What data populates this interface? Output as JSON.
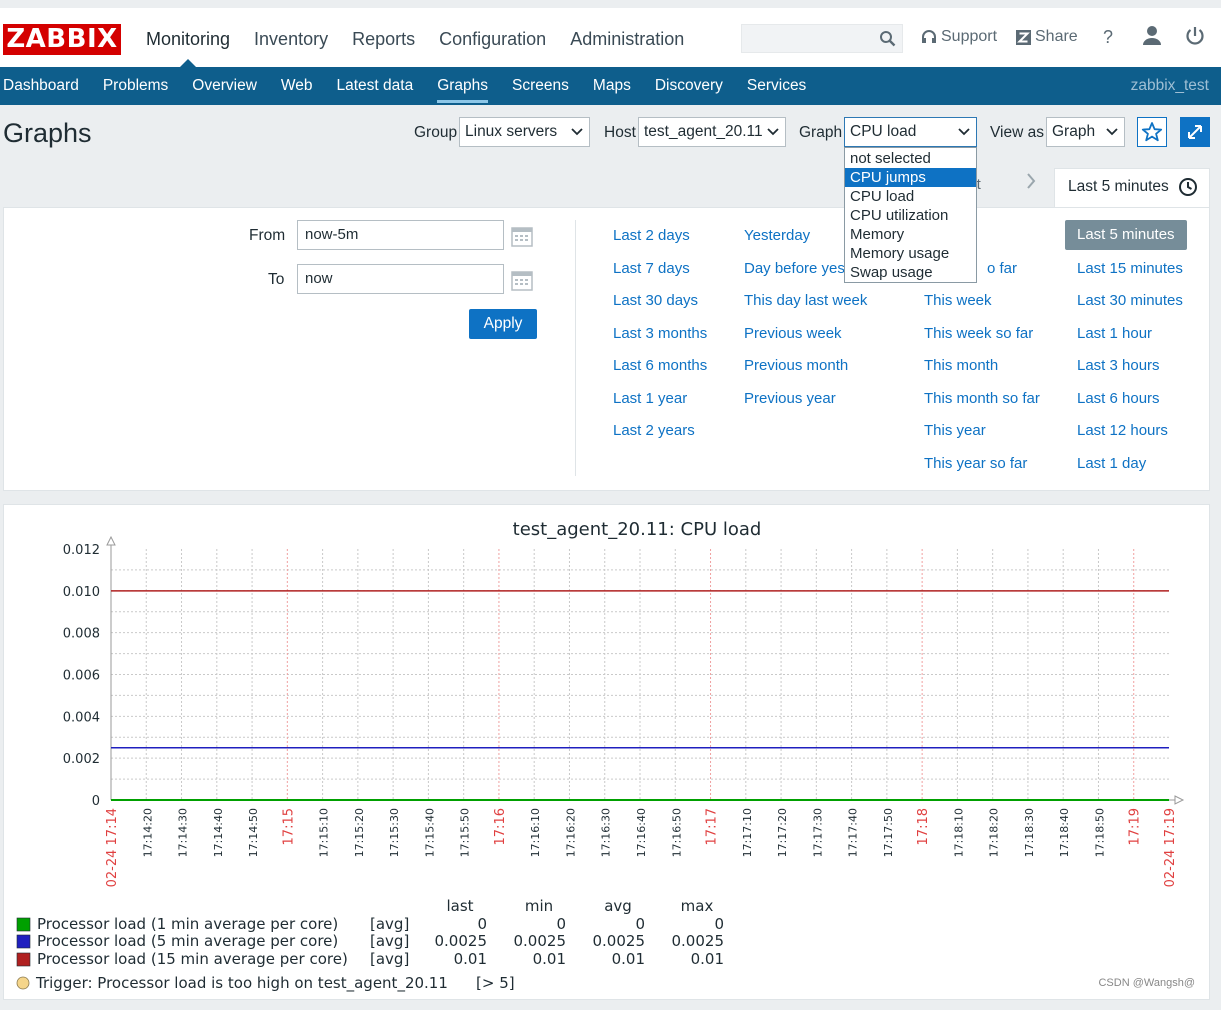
{
  "logo": "ZABBIX",
  "main_menu": [
    "Monitoring",
    "Inventory",
    "Reports",
    "Configuration",
    "Administration"
  ],
  "header_links": {
    "support": "Support",
    "share": "Share",
    "help": "?"
  },
  "sub_menu": [
    "Dashboard",
    "Problems",
    "Overview",
    "Web",
    "Latest data",
    "Graphs",
    "Screens",
    "Maps",
    "Discovery",
    "Services"
  ],
  "user": "zabbix_test",
  "page": {
    "title": "Graphs",
    "group_label": "Group",
    "group_value": "Linux servers",
    "host_label": "Host",
    "host_value": "test_agent_20.11",
    "graph_label": "Graph",
    "graph_value": "CPU load",
    "view_label": "View as",
    "view_value": "Graph"
  },
  "graph_options": [
    "not selected",
    "CPU jumps",
    "CPU load",
    "CPU utilization",
    "Memory",
    "Memory usage",
    "Swap usage"
  ],
  "timeline": {
    "zoom_out": "out",
    "active_tab": "Last 5 minutes"
  },
  "filter": {
    "from_label": "From",
    "from_value": "now-5m",
    "to_label": "To",
    "to_value": "now",
    "apply": "Apply"
  },
  "quick_ranges": {
    "col1": [
      "Last 2 days",
      "Last 7 days",
      "Last 30 days",
      "Last 3 months",
      "Last 6 months",
      "Last 1 year",
      "Last 2 years"
    ],
    "col2": [
      "Yesterday",
      "Day before yes",
      "This day last week",
      "Previous week",
      "Previous month",
      "Previous year"
    ],
    "col3": [
      "o far",
      "This week",
      "This week so far",
      "This month",
      "This month so far",
      "This year",
      "This year so far"
    ],
    "col4": [
      "Last 5 minutes",
      "Last 15 minutes",
      "Last 30 minutes",
      "Last 1 hour",
      "Last 3 hours",
      "Last 6 hours",
      "Last 12 hours",
      "Last 1 day"
    ]
  },
  "chart_data": {
    "type": "line",
    "title": "test_agent_20.11: CPU load",
    "ylim": [
      0,
      0.012
    ],
    "yticks": [
      "0.012",
      "0.010",
      "0.008",
      "0.006",
      "0.004",
      "0.002",
      "0"
    ],
    "xticks": [
      {
        "label": "02-24 17:14",
        "red": true
      },
      {
        "label": "17:14:20",
        "red": false
      },
      {
        "label": "17:14:30",
        "red": false
      },
      {
        "label": "17:14:40",
        "red": false
      },
      {
        "label": "17:14:50",
        "red": false
      },
      {
        "label": "17:15",
        "red": true
      },
      {
        "label": "17:15:10",
        "red": false
      },
      {
        "label": "17:15:20",
        "red": false
      },
      {
        "label": "17:15:30",
        "red": false
      },
      {
        "label": "17:15:40",
        "red": false
      },
      {
        "label": "17:15:50",
        "red": false
      },
      {
        "label": "17:16",
        "red": true
      },
      {
        "label": "17:16:10",
        "red": false
      },
      {
        "label": "17:16:20",
        "red": false
      },
      {
        "label": "17:16:30",
        "red": false
      },
      {
        "label": "17:16:40",
        "red": false
      },
      {
        "label": "17:16:50",
        "red": false
      },
      {
        "label": "17:17",
        "red": true
      },
      {
        "label": "17:17:10",
        "red": false
      },
      {
        "label": "17:17:20",
        "red": false
      },
      {
        "label": "17:17:30",
        "red": false
      },
      {
        "label": "17:17:40",
        "red": false
      },
      {
        "label": "17:17:50",
        "red": false
      },
      {
        "label": "17:18",
        "red": true
      },
      {
        "label": "17:18:10",
        "red": false
      },
      {
        "label": "17:18:20",
        "red": false
      },
      {
        "label": "17:18:30",
        "red": false
      },
      {
        "label": "17:18:40",
        "red": false
      },
      {
        "label": "17:18:50",
        "red": false
      },
      {
        "label": "17:19",
        "red": true
      },
      {
        "label": "02-24 17:19",
        "red": true
      }
    ],
    "series": [
      {
        "name": "Processor load (1 min average per core)",
        "color": "#00a000",
        "value": 0
      },
      {
        "name": "Processor load (5 min average per core)",
        "color": "#1f1fbf",
        "value": 0.0025
      },
      {
        "name": "Processor load (15 min average per core)",
        "color": "#b02020",
        "value": 0.01
      }
    ],
    "legend_headers": [
      "last",
      "min",
      "avg",
      "max"
    ],
    "legend": [
      {
        "name": "Processor load (1 min average per core)",
        "fn": "[avg]",
        "stats": [
          "0",
          "0",
          "0",
          "0"
        ]
      },
      {
        "name": "Processor load (5 min average per core)",
        "fn": "[avg]",
        "stats": [
          "0.0025",
          "0.0025",
          "0.0025",
          "0.0025"
        ]
      },
      {
        "name": "Processor load (15 min average per core)",
        "fn": "[avg]",
        "stats": [
          "0.01",
          "0.01",
          "0.01",
          "0.01"
        ]
      }
    ],
    "trigger": {
      "text": "Trigger: Processor load is too high on test_agent_20.11",
      "condition": "[> 5]",
      "color": "#f5d58a"
    }
  },
  "watermark": "CSDN @Wangsh@"
}
